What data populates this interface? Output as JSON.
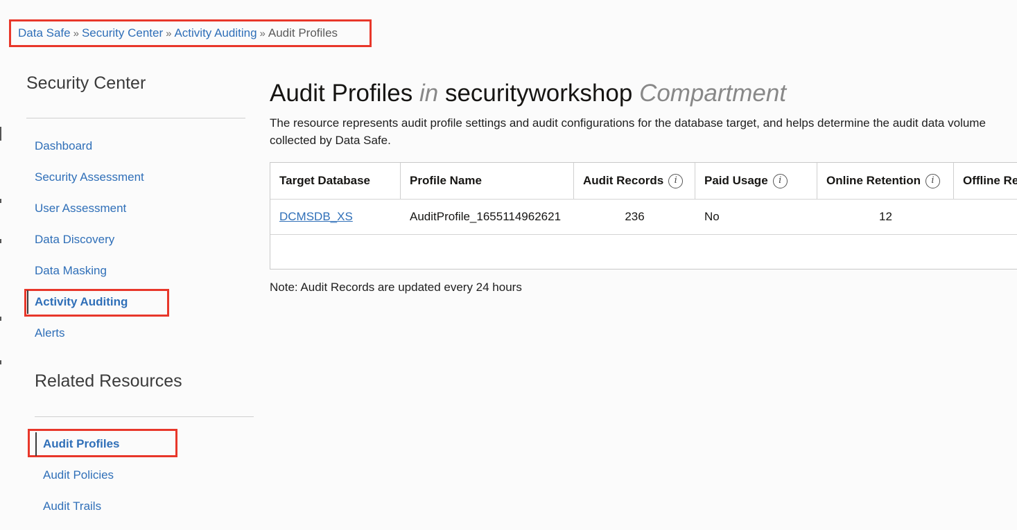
{
  "breadcrumb": {
    "items": [
      "Data Safe",
      "Security Center",
      "Activity Auditing"
    ],
    "separator": "»",
    "current": "Audit Profiles"
  },
  "sidebar": {
    "heading": "Security Center",
    "items": [
      {
        "label": "Dashboard"
      },
      {
        "label": "Security Assessment"
      },
      {
        "label": "User Assessment"
      },
      {
        "label": "Data Discovery"
      },
      {
        "label": "Data Masking"
      },
      {
        "label": "Activity Auditing",
        "active": true
      },
      {
        "label": "Alerts"
      }
    ],
    "related_heading": "Related Resources",
    "related_items": [
      {
        "label": "Audit Profiles",
        "active": true
      },
      {
        "label": "Audit Policies"
      },
      {
        "label": "Audit Trails"
      }
    ]
  },
  "main": {
    "title": "Audit Profiles",
    "title_in": "in",
    "compartment": "securityworkshop",
    "compartment_suffix": "Compartment",
    "description": "The resource represents audit profile settings and audit configurations for the database target, and helps determine the audit data volume collected by Data Safe.",
    "table": {
      "columns": [
        {
          "label": "Target Database",
          "info": false
        },
        {
          "label": "Profile Name",
          "info": false
        },
        {
          "label": "Audit Records",
          "info": true
        },
        {
          "label": "Paid Usage",
          "info": true
        },
        {
          "label": "Online Retention",
          "info": true
        },
        {
          "label": "Offline Retention",
          "info": true
        }
      ],
      "rows": [
        {
          "target_database": "DCMSDB_XS",
          "profile_name": "AuditProfile_1655114962621",
          "audit_records": "236",
          "paid_usage": "No",
          "online_retention": "12"
        }
      ],
      "info_glyph": "i"
    },
    "note": "Note: Audit Records are updated every 24 hours"
  },
  "colors": {
    "link": "#2f6fb8",
    "annotation": "#e8372a",
    "background": "#fbfbfb"
  }
}
